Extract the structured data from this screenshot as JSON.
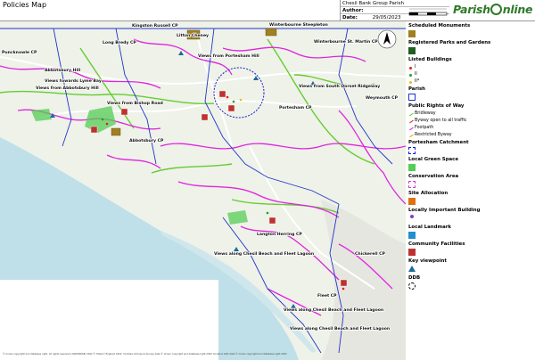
{
  "window_title": "Policies Map",
  "header": {
    "parish_name": "Chesil Bank Group Parish",
    "author_label": "Author:",
    "author_value": "",
    "date_label": "Date:",
    "date_value": "29/05/2023",
    "brand": "Parish",
    "brand_tail": "nline"
  },
  "map": {
    "place_labels": [
      "Kingston Russell CP",
      "Litton Cheney",
      "Winterbourne Steepleton",
      "Winterbourne St. Martin CP",
      "Puncknowle CP",
      "Long Bredy CP",
      "Abbotsbury Hill",
      "Views towards Lyme Bay",
      "Views from Abbotsbury Hill",
      "Views from Bishop Road",
      "Views from Portesham Hill",
      "Views from South Dorset Ridgeway",
      "Portesham CP",
      "Weymouth CP",
      "Abbotsbury CP",
      "Langton Herring CP",
      "Views along Chesil Beach and Fleet Lagoon",
      "Fleet CP",
      "Views along Chesil Beach and Fleet Lagoon",
      "Views along Chesil Beach and Fleet Lagoon",
      "Chickerell CP"
    ],
    "colors": {
      "sea": "#bfe0e8",
      "land": "#eef2e8",
      "bridleway": "#66cc33",
      "footpath": "#e024e0",
      "byway": "#e52020",
      "road": "#ffffff",
      "parish": "#2233cc",
      "catchment": "#1a1acc"
    }
  },
  "legend": {
    "items": [
      {
        "label": "Scheduled Monuments",
        "kind": "title",
        "swatch": "#a08020"
      },
      {
        "label": "Registered Parks and Gardens",
        "kind": "title",
        "swatch": "#1f5f1f"
      },
      {
        "label": "Listed Buildings",
        "kind": "title",
        "swatch": ""
      },
      {
        "label": "I",
        "kind": "sub",
        "swatch": "#e02020"
      },
      {
        "label": "II",
        "kind": "sub",
        "swatch": "#20a020"
      },
      {
        "label": "II*",
        "kind": "sub",
        "swatch": "#e0c020"
      },
      {
        "label": "Parish",
        "kind": "title",
        "swatch": "#2233cc"
      },
      {
        "label": "Public Rights of Way",
        "kind": "title",
        "swatch": ""
      },
      {
        "label": "Bridleway",
        "kind": "sub",
        "swatch": "#66cc33"
      },
      {
        "label": "Byway open to all traffic",
        "kind": "sub",
        "swatch": "#e52020"
      },
      {
        "label": "Footpath",
        "kind": "sub",
        "swatch": "#e024e0"
      },
      {
        "label": "Restricted Byway",
        "kind": "sub",
        "swatch": "#f0a000"
      },
      {
        "label": "Portesham Catchment",
        "kind": "title",
        "swatch": "#1a1acc"
      },
      {
        "label": "Local Green Space",
        "kind": "title",
        "swatch": "#55cc55"
      },
      {
        "label": "Conservation Area",
        "kind": "title",
        "swatch": "#d040d0"
      },
      {
        "label": "Site Allocation",
        "kind": "title",
        "swatch": "#e07010"
      },
      {
        "label": "Locally Important Building",
        "kind": "title",
        "swatch": "#8040c0"
      },
      {
        "label": "Local Landmark",
        "kind": "title",
        "swatch": "#2090d0"
      },
      {
        "label": "Community Facilities",
        "kind": "title",
        "swatch": "#c03030"
      },
      {
        "label": "Key viewpoint",
        "kind": "title",
        "swatch": "#1a6a9a"
      },
      {
        "label": "DDB",
        "kind": "title",
        "swatch": "#000000"
      }
    ]
  },
  "attribution": "© Crown copyright and database right. All rights reserved (100050638) 2022 © Historic England 2022. Contains Ordnance Survey data © Crown copyright and database right 2022 Contains GDS data © Crown copyright and database right 2022"
}
